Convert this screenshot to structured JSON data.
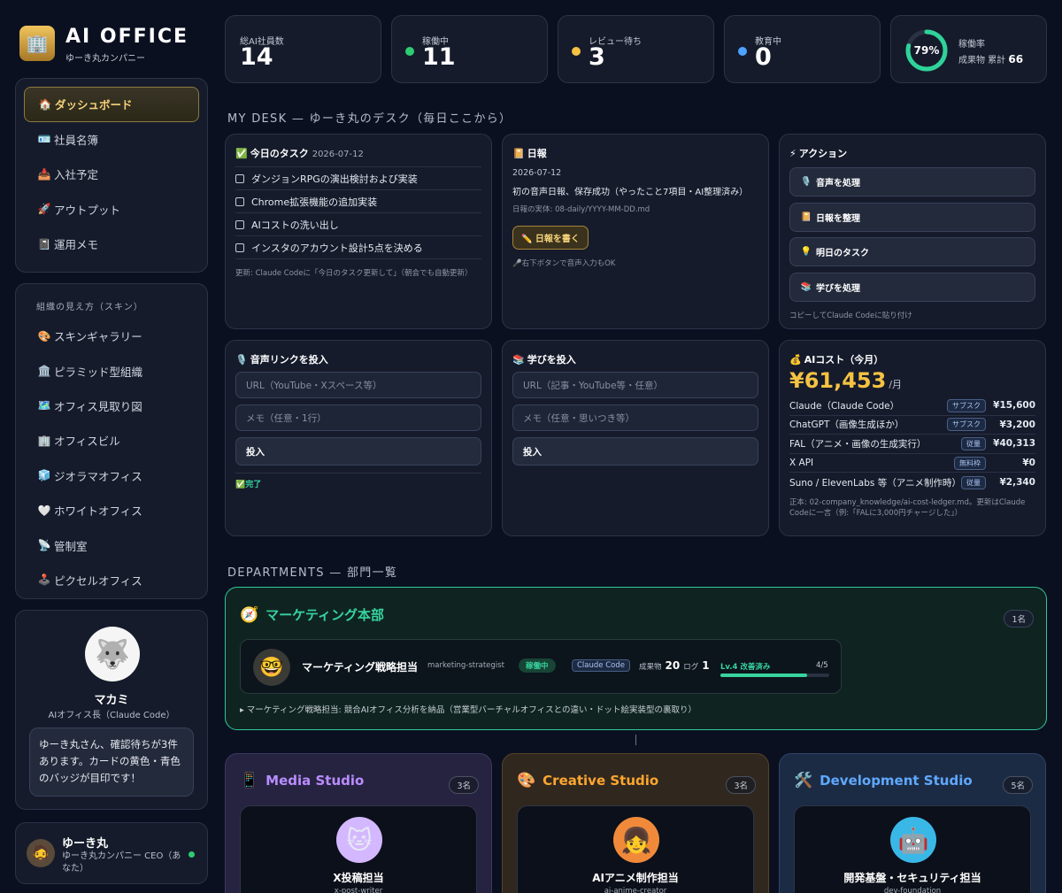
{
  "app": {
    "logo_icon": "office-building-icon",
    "title": "AI OFFICE",
    "subtitle": "ゆーき丸カンパニー"
  },
  "nav_main": [
    {
      "icon": "🏠",
      "label": "ダッシュボード",
      "active": true
    },
    {
      "icon": "🪪",
      "label": "社員名簿"
    },
    {
      "icon": "📥",
      "label": "入社予定"
    },
    {
      "icon": "🚀",
      "label": "アウトプット"
    },
    {
      "icon": "📓",
      "label": "運用メモ"
    }
  ],
  "nav_skin": {
    "heading": "組織の見え方（スキン）",
    "items": [
      {
        "icon": "🎨",
        "label": "スキンギャラリー"
      },
      {
        "icon": "🏛️",
        "label": "ピラミッド型組織"
      },
      {
        "icon": "🗺️",
        "label": "オフィス見取り図"
      },
      {
        "icon": "🏢",
        "label": "オフィスビル"
      },
      {
        "icon": "🧊",
        "label": "ジオラマオフィス"
      },
      {
        "icon": "🤍",
        "label": "ホワイトオフィス"
      },
      {
        "icon": "📡",
        "label": "管制室"
      },
      {
        "icon": "🕹️",
        "label": "ピクセルオフィス"
      }
    ]
  },
  "mascot": {
    "name": "マカミ",
    "role": "AIオフィス長（Claude Code）",
    "message": "ゆーき丸さん、確認待ちが3件あります。カードの黄色・青色のバッジが目印です！"
  },
  "user": {
    "name": "ゆーき丸",
    "role": "ゆーき丸カンパニー CEO（あなた）",
    "status_color": "#2ecc71"
  },
  "stats": [
    {
      "label": "総AI社員数",
      "value": "14"
    },
    {
      "label": "稼働中",
      "value": "11",
      "dot": "#2ecc71"
    },
    {
      "label": "レビュー待ち",
      "value": "3",
      "dot": "#f5c242"
    },
    {
      "label": "教育中",
      "value": "0",
      "dot": "#4da3ff"
    }
  ],
  "utilization": {
    "percent": 79,
    "percent_label": "79%",
    "label": "稼働率",
    "sub_label": "成果物 累計",
    "total": "66",
    "color": "#2fd39a"
  },
  "mydesk": {
    "heading": "MY DESK — ゆーき丸のデスク（毎日ここから）",
    "tasks": {
      "icon": "✅",
      "title": "今日のタスク",
      "date": "2026-07-12",
      "items": [
        "ダンジョンRPGの演出検討および実装",
        "Chrome拡張機能の追加実装",
        "AIコストの洗い出し",
        "インスタのアカウント設計5点を決める"
      ],
      "note": "更新: Claude Codeに「今日のタスク更新して」（朝会でも自動更新）"
    },
    "daily": {
      "icon": "📔",
      "title": "日報",
      "date": "2026-07-12",
      "summary": "初の音声日報、保存成功（やったこと7項目・AI整理済み）",
      "path": "日報の実体: 08-daily/YYYY-MM-DD.md",
      "button": "✏️ 日報を書く",
      "note": "🎤右下ボタンで音声入力もOK"
    },
    "actions": {
      "icon": "⚡",
      "title": "アクション",
      "items": [
        {
          "icon": "🎙️",
          "label": "音声を処理"
        },
        {
          "icon": "📔",
          "label": "日報を整理"
        },
        {
          "icon": "💡",
          "label": "明日のタスク"
        },
        {
          "icon": "📚",
          "label": "学びを処理"
        }
      ],
      "note": "コピーしてClaude Codeに貼り付け"
    },
    "voice": {
      "icon": "🎙️",
      "title": "音声リンクを投入",
      "url_placeholder": "URL（YouTube・Xスペース等）",
      "memo_placeholder": "メモ（任意・1行）",
      "submit": "投入",
      "done": "✅完了"
    },
    "learn": {
      "icon": "📚",
      "title": "学びを投入",
      "url_placeholder": "URL（記事・YouTube等・任意）",
      "memo_placeholder": "メモ（任意・思いつき等）",
      "submit": "投入"
    },
    "cost": {
      "icon": "💰",
      "title": "AIコスト（今月）",
      "total": "¥61,453",
      "unit": "/月",
      "rows": [
        {
          "name": "Claude（Claude Code）",
          "tag": "サブスク",
          "amount": "¥15,600"
        },
        {
          "name": "ChatGPT（画像生成ほか）",
          "tag": "サブスク",
          "amount": "¥3,200"
        },
        {
          "name": "FAL（アニメ・画像の生成実行）",
          "tag": "従量",
          "amount": "¥40,313"
        },
        {
          "name": "X API",
          "tag": "無料枠",
          "amount": "¥0"
        },
        {
          "name": "Suno / ElevenLabs 等（アニメ制作時）",
          "tag": "従量",
          "amount": "¥2,340"
        }
      ],
      "note": "正本: 02-company_knowledge/ai-cost-ledger.md。更新はClaude Codeに一言（例:「FALに3,000円チャージした」）"
    }
  },
  "departments": {
    "heading": "DEPARTMENTS — 部門一覧",
    "main": {
      "icon": "🧭",
      "name": "マーケティング本部",
      "count": "1名",
      "member": {
        "avatar": "🤓",
        "name": "マーケティング戦略担当",
        "id": "marketing-strategist",
        "status": "稼働中",
        "tool": "Claude Code",
        "output_label": "成果物",
        "output": "20",
        "log_label": "ログ",
        "log": "1",
        "level": "Lv.4 改善済み",
        "progress_label": "4/5",
        "progress": 0.8
      },
      "note": "▸ マーケティング戦略担当: 競合AIオフィス分析を納品（営業型バーチャルオフィスとの違い・ドット絵実装型の裏取り）"
    },
    "studios": [
      {
        "icon": "📱",
        "name": "Media Studio",
        "count": "3名",
        "color": "#b98cff",
        "bg": "#262340",
        "member": {
          "avatar": "🐱",
          "name": "X投稿担当",
          "id": "x-post-writer",
          "avatar_bg": "#d4b8ff"
        }
      },
      {
        "icon": "🎨",
        "name": "Creative Studio",
        "count": "3名",
        "color": "#ffa630",
        "bg": "#30281e",
        "member": {
          "avatar": "👧",
          "name": "AIアニメ制作担当",
          "id": "ai-anime-creator",
          "avatar_bg": "#f08a3a"
        }
      },
      {
        "icon": "🛠️",
        "name": "Development Studio",
        "count": "5名",
        "color": "#5fa8ff",
        "bg": "#1c2b44",
        "member": {
          "avatar": "🤖",
          "name": "開発基盤・セキュリティ担当",
          "id": "dev-foundation",
          "avatar_bg": "#39b8e8"
        }
      }
    ]
  }
}
